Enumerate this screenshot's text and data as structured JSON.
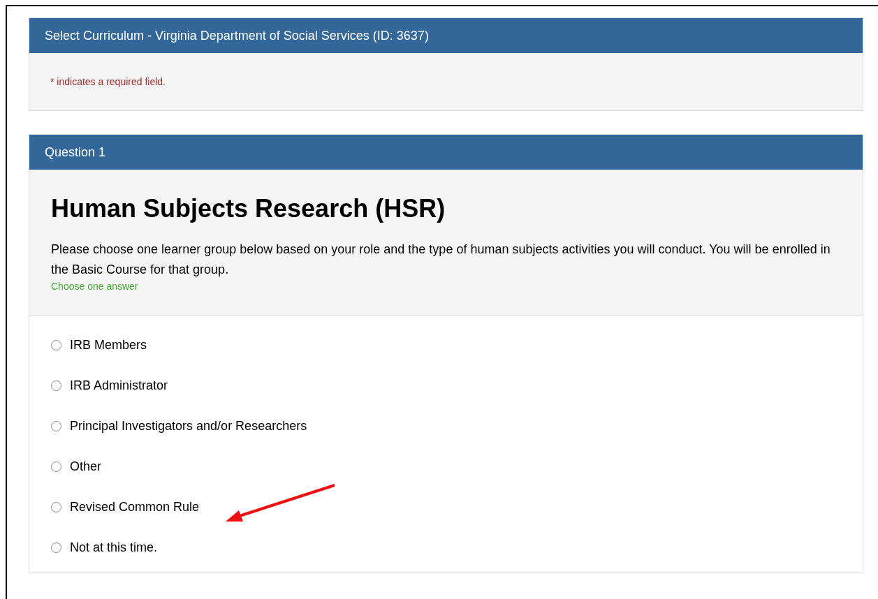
{
  "curriculum_panel": {
    "title": "Select Curriculum - Virginia Department of Social Services (ID: 3637)",
    "required_note": "* indicates a required field."
  },
  "question_panel": {
    "title": "Question 1",
    "heading": "Human Subjects Research (HSR)",
    "prompt": "Please choose one learner group below based on your role and the type of human subjects activities you will conduct. You will be enrolled in the Basic Course for that group.",
    "hint": "Choose one answer",
    "options": [
      {
        "label": "IRB Members",
        "selected": false
      },
      {
        "label": "IRB Administrator",
        "selected": false
      },
      {
        "label": "Principal Investigators and/or Researchers",
        "selected": false
      },
      {
        "label": "Other",
        "selected": false
      },
      {
        "label": "Revised Common Rule",
        "selected": false
      },
      {
        "label": "Not at this time.",
        "selected": false
      }
    ]
  }
}
